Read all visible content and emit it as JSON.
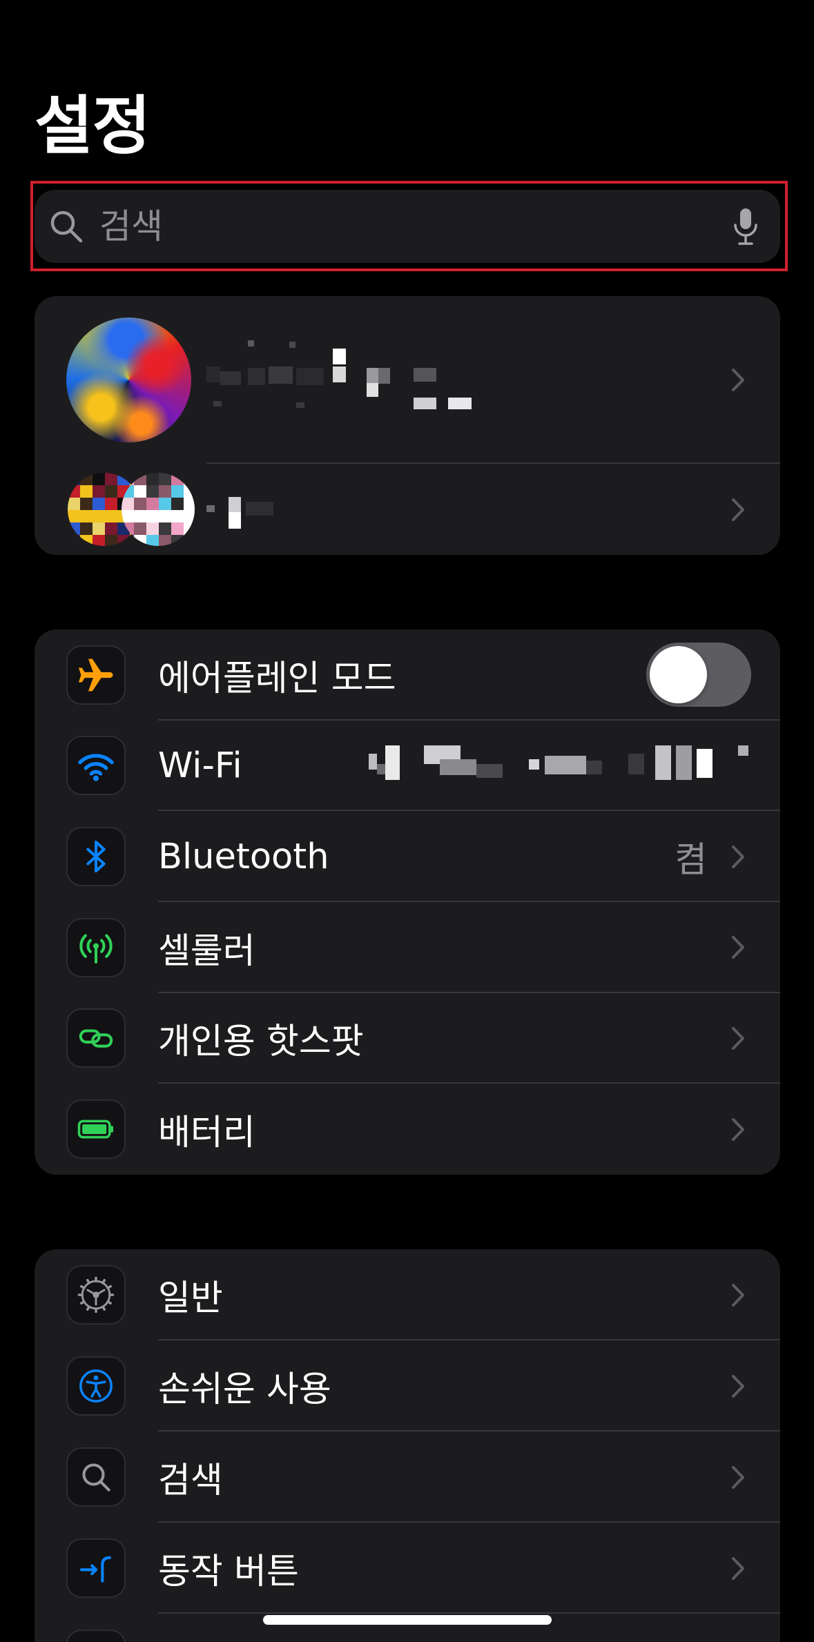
{
  "header": {
    "title": "설정"
  },
  "search": {
    "placeholder": "검색",
    "icon": "search-icon",
    "mic_icon": "microphone-icon"
  },
  "account": {
    "avatar_icon": "profile-avatar",
    "family_icon": "family-avatars"
  },
  "connectivity": {
    "items": [
      {
        "label": "에어플레인 모드",
        "icon": "airplane-icon",
        "color": "#FF9F0A",
        "enabled": false
      },
      {
        "label": "Wi-Fi",
        "icon": "wifi-icon",
        "color": "#0A84FF"
      },
      {
        "label": "Bluetooth",
        "icon": "bluetooth-icon",
        "color": "#0A84FF",
        "value": "켬"
      },
      {
        "label": "셀룰러",
        "icon": "antenna-icon",
        "color": "#30D158"
      },
      {
        "label": "개인용 핫스팟",
        "icon": "chain-link-icon",
        "color": "#30D158"
      },
      {
        "label": "배터리",
        "icon": "battery-icon",
        "color": "#30D158"
      }
    ]
  },
  "system": {
    "items": [
      {
        "label": "일반",
        "icon": "gear-icon",
        "color": "#98989D"
      },
      {
        "label": "손쉬운 사용",
        "icon": "accessibility-icon",
        "color": "#0A84FF"
      },
      {
        "label": "검색",
        "icon": "search-icon",
        "color": "#98989D"
      },
      {
        "label": "동작 버튼",
        "icon": "action-button-icon",
        "color": "#0A84FF"
      }
    ]
  },
  "colors": {
    "background": "#000000",
    "group": "#1C1C1E",
    "separator": "#38383A",
    "secondary_text": "#8E8E93",
    "highlight": "#D0202E",
    "chevron": "#5B5B60"
  }
}
